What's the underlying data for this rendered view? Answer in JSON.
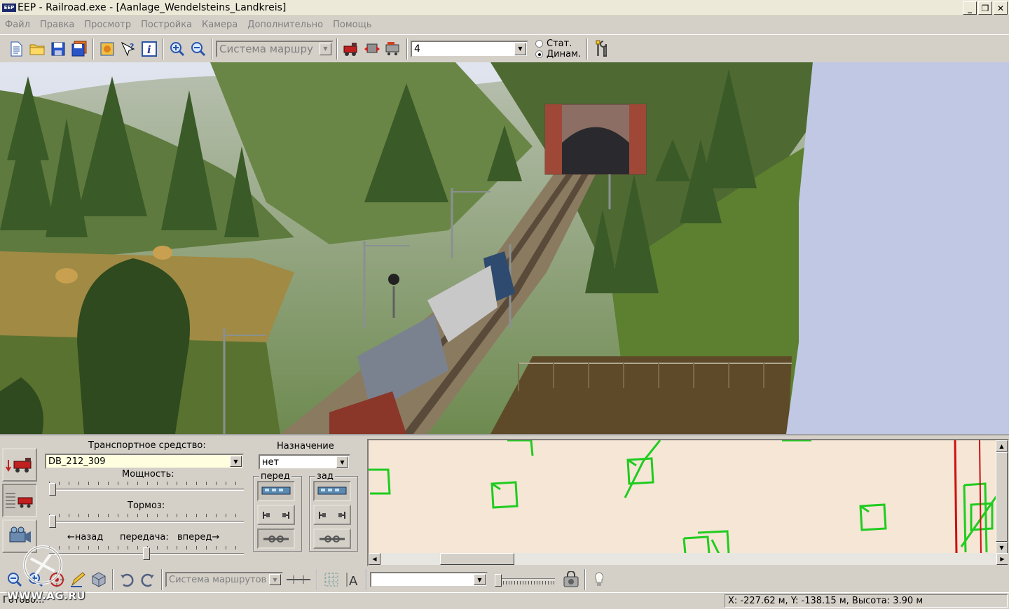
{
  "window": {
    "logo_text": "EEP",
    "title": "EEP - Railroad.exe - [Aanlage_Wendelsteins_Landkreis]",
    "min_label": "_",
    "restore_label": "❐",
    "close_label": "✕"
  },
  "menu": {
    "items": [
      "Файл",
      "Правка",
      "Просмотр",
      "Постройка",
      "Камера",
      "Дополнительно",
      "Помощь"
    ]
  },
  "toolbar": {
    "route_system_value": "Система маршру",
    "camera_number_value": "4",
    "radio_static_label": "Стат.",
    "radio_dynamic_label": "Динам.",
    "selected_mode": "Динам."
  },
  "vehicle_panel": {
    "vehicle_label": "Транспортное средство:",
    "vehicle_value": "DB_212_309",
    "destination_label": "Назначение",
    "destination_value": "нет",
    "power_label": "Мощность:",
    "brake_label": "Тормоз:",
    "back_label": "←назад",
    "gear_label": "передача:",
    "forward_label": "вперед→",
    "front_group_label": "перед",
    "rear_group_label": "зад",
    "power_level": 0.0,
    "brake_level": 0.0,
    "gear_level": 0.5
  },
  "bottom_toolbar": {
    "route_system_value": "Система маршрутов",
    "empty_combo_value": ""
  },
  "status": {
    "left": "Готово...",
    "coords": "X: -227.62 м, Y: -138.15 м, Высота: 3.90 м"
  },
  "watermark": {
    "text": "WWW.AG.RU"
  },
  "colors": {
    "chrome": "#d4d0c8",
    "map_bg": "#f5e6d6",
    "map_lines": "#1fcc1f",
    "map_red": "#cc1010",
    "sky": "#c0c8e4"
  }
}
